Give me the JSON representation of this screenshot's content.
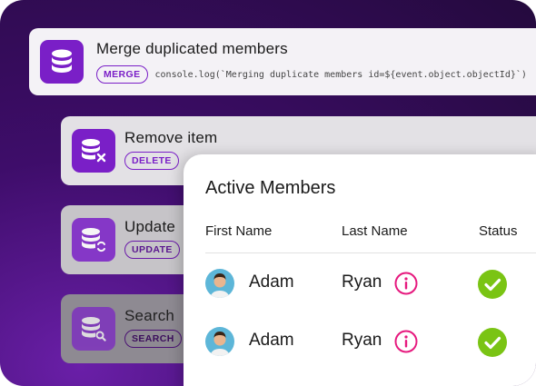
{
  "colors": {
    "accent": "#7a1fc7",
    "success": "#7ac414",
    "info": "#e6197e"
  },
  "cards": [
    {
      "title": "Merge duplicated members",
      "tag": "MERGE",
      "code": "console.log(`Merging duplicate members id=${event.object.objectId}`)",
      "icon": "database-icon"
    },
    {
      "title": "Remove item",
      "tag": "DELETE",
      "icon": "database-delete-icon"
    },
    {
      "title": "Update",
      "tag": "UPDATE",
      "icon": "database-sync-icon"
    },
    {
      "title": "Search",
      "tag": "SEARCH",
      "icon": "database-search-icon"
    }
  ],
  "members_table": {
    "title": "Active Members",
    "columns": [
      "First Name",
      "Last Name",
      "Status"
    ],
    "rows": [
      {
        "first": "Adam",
        "last": "Ryan",
        "status": "active"
      },
      {
        "first": "Adam",
        "last": "Ryan",
        "status": "active"
      }
    ]
  }
}
